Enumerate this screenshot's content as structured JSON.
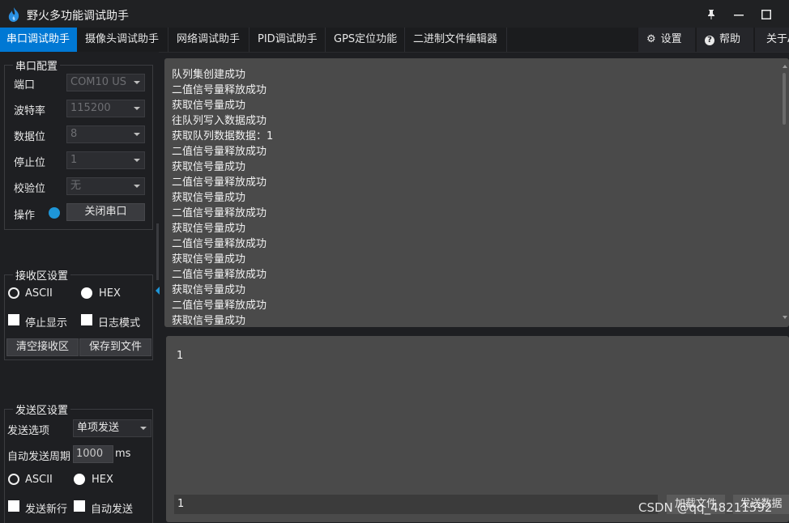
{
  "window": {
    "title": "野火多功能调试助手"
  },
  "tabs": [
    "串口调试助手",
    "摄像头调试助手",
    "网络调试助手",
    "PID调试助手",
    "GPS定位功能",
    "二进制文件编辑器"
  ],
  "right_buttons": {
    "settings": "设置",
    "help": "帮助",
    "about": "关于A"
  },
  "serial": {
    "group_title": "串口配置",
    "port_label": "端口",
    "port_value": "COM10 US",
    "baud_label": "波特率",
    "baud_value": "115200",
    "databits_label": "数据位",
    "databits_value": "8",
    "stopbits_label": "停止位",
    "stopbits_value": "1",
    "parity_label": "校验位",
    "parity_value": "无",
    "op_label": "操作",
    "close_button": "关闭串口",
    "status_color": "#1e96d8"
  },
  "receive_settings": {
    "group_title": "接收区设置",
    "ascii": "ASCII",
    "hex": "HEX",
    "stop_display": "停止显示",
    "log_mode": "日志模式",
    "clear_button": "清空接收区",
    "save_button": "保存到文件"
  },
  "send_settings": {
    "group_title": "发送区设置",
    "option_label": "发送选项",
    "option_value": "单项发送",
    "period_label": "自动发送周期",
    "period_value": "1000",
    "period_unit": "ms",
    "ascii": "ASCII",
    "hex": "HEX",
    "newline": "发送新行",
    "auto_send": "自动发送"
  },
  "receive_lines": [
    "队列集创建成功",
    "二值信号量释放成功",
    "获取信号量成功",
    "往队列写入数据成功",
    "获取队列数据数据：1",
    "二值信号量释放成功",
    "获取信号量成功",
    "二值信号量释放成功",
    "获取信号量成功",
    "二值信号量释放成功",
    "获取信号量成功",
    "二值信号量释放成功",
    "获取信号量成功",
    "二值信号量释放成功",
    "获取信号量成功",
    "二值信号量释放成功",
    "获取信号量成功"
  ],
  "send_area": {
    "text": "1",
    "input_value": "1",
    "load_file": "加载文件",
    "send_data": "发送数据"
  },
  "watermark": "CSDN @qq_48211592"
}
